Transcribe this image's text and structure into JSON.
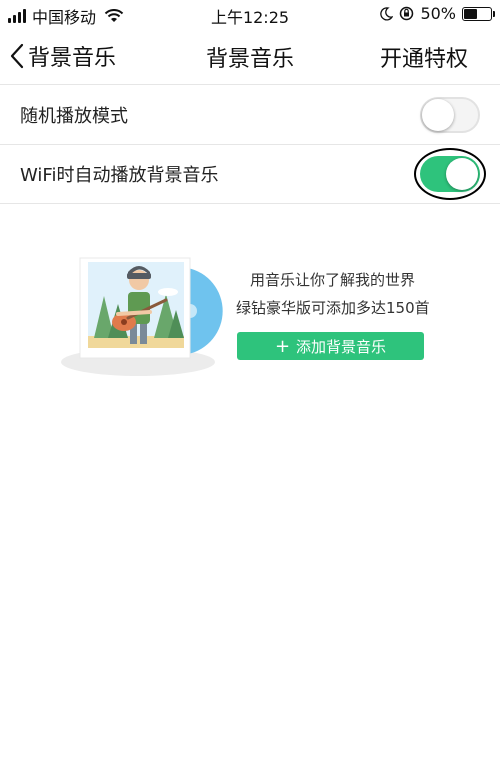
{
  "status_bar": {
    "carrier": "中国移动",
    "time": "上午12:25",
    "battery_percent": "50%",
    "battery_level": 0.5
  },
  "nav": {
    "back_label": "背景音乐",
    "title": "背景音乐",
    "right_action": "开通特权"
  },
  "settings": [
    {
      "label": "随机播放模式",
      "enabled": false
    },
    {
      "label": "WiFi时自动播放背景音乐",
      "enabled": true
    }
  ],
  "promo": {
    "line1": "用音乐让你了解我的世界",
    "line2": "绿钻豪华版可添加多达150首",
    "button_label": "添加背景音乐",
    "button_icon": "plus-icon"
  },
  "colors": {
    "accent_green": "#2ec37c",
    "disc_blue": "#6fc3ee"
  }
}
